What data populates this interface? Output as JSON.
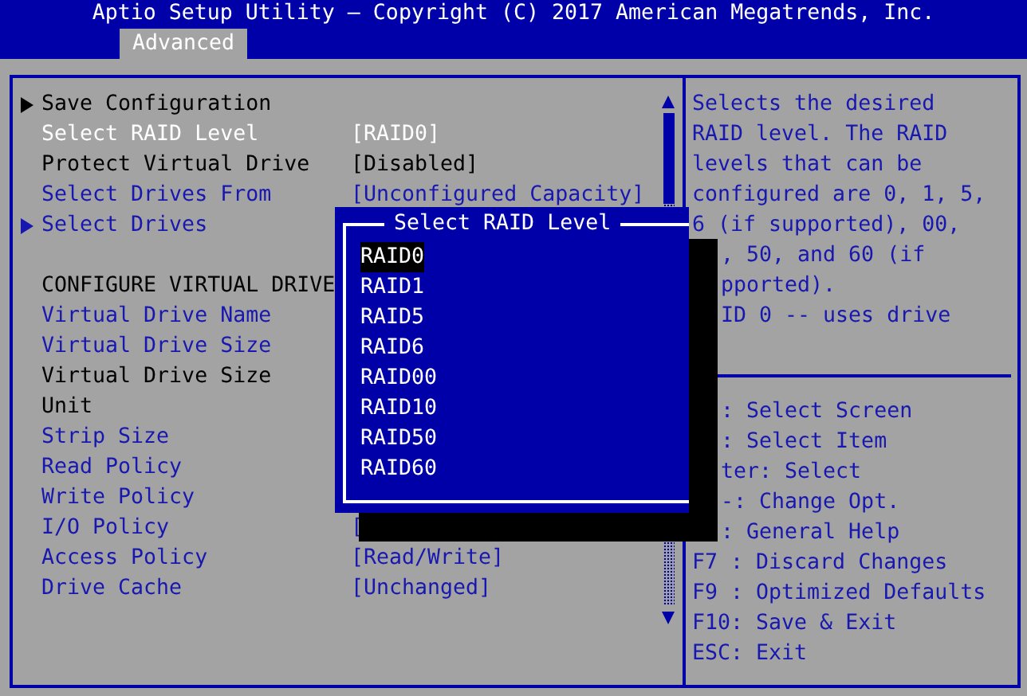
{
  "title": "Aptio Setup Utility – Copyright (C) 2017 American Megatrends, Inc.",
  "tabs": [
    {
      "label": "Advanced",
      "selected": true
    }
  ],
  "menu": [
    {
      "label": "Save Configuration",
      "kind": "submenu",
      "selected": false,
      "readonly": true
    },
    {
      "label": "Select RAID Level",
      "kind": "option",
      "selected": true,
      "value": "[RAID0]"
    },
    {
      "label": "Protect Virtual Drive",
      "kind": "option",
      "selected": false,
      "readonly": true,
      "value": "[Disabled]"
    },
    {
      "label": "Select Drives From",
      "kind": "option",
      "selected": false,
      "readonly": false,
      "value": "[Unconfigured Capacity]"
    },
    {
      "label": "Select Drives",
      "kind": "submenu",
      "selected": false,
      "readonly": false
    },
    {
      "label": "CONFIGURE VIRTUAL DRIVE",
      "kind": "heading",
      "selected": false,
      "readonly": true
    },
    {
      "label": "Virtual Drive Name",
      "kind": "option",
      "selected": false,
      "readonly": false
    },
    {
      "label": "Virtual Drive Size",
      "kind": "option",
      "selected": false,
      "readonly": false
    },
    {
      "label": "Virtual Drive Size",
      "kind": "option",
      "selected": false,
      "readonly": true
    },
    {
      "label": "Unit",
      "kind": "option",
      "selected": false,
      "readonly": true
    },
    {
      "label": "Strip Size",
      "kind": "option",
      "selected": false,
      "readonly": false
    },
    {
      "label": "Read Policy",
      "kind": "option",
      "selected": false,
      "readonly": false
    },
    {
      "label": "Write Policy",
      "kind": "option",
      "selected": false,
      "readonly": false
    },
    {
      "label": "I/O Policy",
      "kind": "option",
      "selected": false,
      "readonly": false,
      "value": "["
    },
    {
      "label": "Access Policy",
      "kind": "option",
      "selected": false,
      "readonly": false,
      "value": "[Read/Write]"
    },
    {
      "label": "Drive Cache",
      "kind": "option",
      "selected": false,
      "readonly": false,
      "value": "[Unchanged]"
    }
  ],
  "popup": {
    "title": "Select RAID Level",
    "options": [
      {
        "label": "RAID0",
        "selected": true
      },
      {
        "label": "RAID1",
        "selected": false
      },
      {
        "label": "RAID5",
        "selected": false
      },
      {
        "label": "RAID6",
        "selected": false
      },
      {
        "label": "RAID00",
        "selected": false
      },
      {
        "label": "RAID10",
        "selected": false
      },
      {
        "label": "RAID50",
        "selected": false
      },
      {
        "label": "RAID60",
        "selected": false
      }
    ]
  },
  "help": [
    {
      "text": "Selects the desired",
      "clipped": false
    },
    {
      "text": "RAID level. The RAID",
      "clipped": false
    },
    {
      "text": "levels that can be",
      "clipped": false
    },
    {
      "text": "configured are 0, 1, 5,",
      "clipped": false
    },
    {
      "text": "6 (if supported), 00,",
      "clipped": false
    },
    {
      "text": ", 50, and 60 (if",
      "clipped": true
    },
    {
      "text": "pported).",
      "clipped": true
    },
    {
      "text": "ID 0 -- uses drive",
      "clipped": true
    }
  ],
  "keys": [
    {
      "text": ": Select Screen",
      "clipped": true
    },
    {
      "text": ": Select Item",
      "clipped": true
    },
    {
      "text": "ter: Select",
      "clipped": true
    },
    {
      "text": "-: Change Opt.",
      "clipped": true
    },
    {
      "text": ": General Help",
      "clipped": true
    },
    {
      "text": "F7 : Discard Changes",
      "clipped": false
    },
    {
      "text": "F9 : Optimized Defaults",
      "clipped": false
    },
    {
      "text": "F10: Save & Exit",
      "clipped": false
    },
    {
      "text": "ESC: Exit",
      "clipped": false
    }
  ]
}
